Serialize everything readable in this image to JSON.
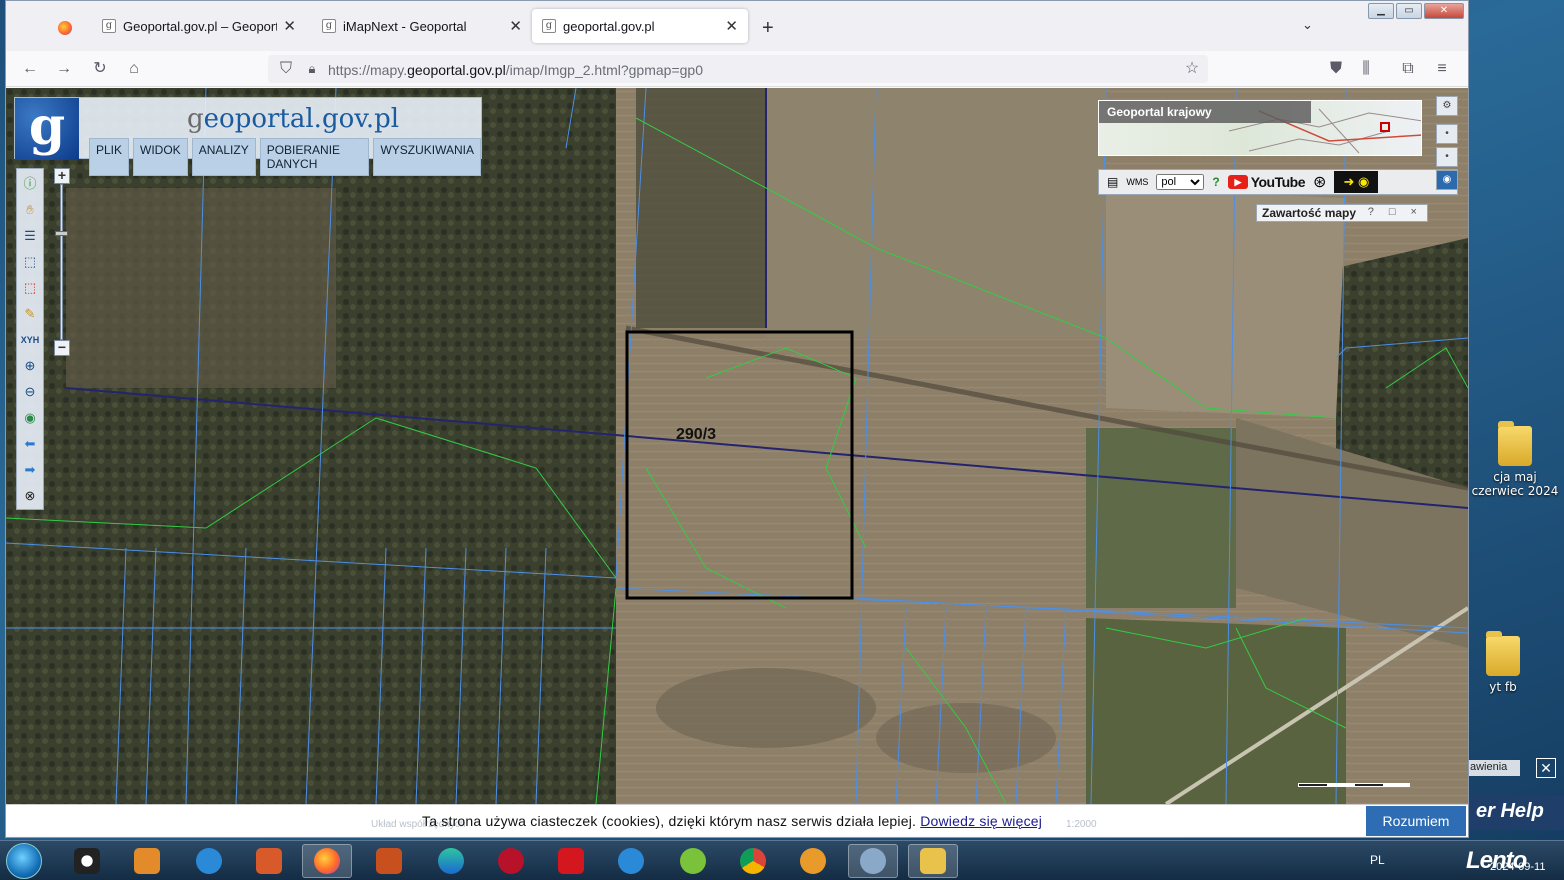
{
  "browser": {
    "tabs": [
      {
        "label": "Geoportal.gov.pl – Geoportal Inf",
        "active": false
      },
      {
        "label": "iMapNext - Geoportal",
        "active": false
      },
      {
        "label": "geoportal.gov.pl",
        "active": true
      }
    ],
    "url_prefix": "https://mapy.",
    "url_domain": "geoportal.gov.pl",
    "url_path": "/imap/Imgp_2.html?gpmap=gp0"
  },
  "geoportal": {
    "logo_letter": "g",
    "logo_text_prefix": "g",
    "logo_text_rest": "eoportal.gov.pl",
    "menu": [
      "PLIK",
      "WIDOK",
      "ANALIZY",
      "POBIERANIE DANYCH",
      "WYSZUKIWANIA"
    ],
    "overview_title": "Geoportal krajowy",
    "language_selected": "pol",
    "youtube_label": "YouTube",
    "map_content_title": "Zawartość mapy",
    "map_content_controls": "? □ ×",
    "parcel_label": "290/3",
    "status_text": "Układ współrzędnych",
    "scale_text": "1:2000"
  },
  "cookie": {
    "text": "Ta strona używa ciasteczek (cookies), dzięki którym nasz serwis działa lepiej.",
    "link": "Dowiedz się więcej",
    "button": "Rozumiem"
  },
  "desktop": {
    "icons": [
      {
        "label": "cja maj czerwiec 2024"
      },
      {
        "label": "yt  fb"
      }
    ],
    "widget_label": "awienia",
    "help_label": "er Help"
  },
  "taskbar": {
    "lang": "PL",
    "date": "2024-09-11",
    "watermark": "Lento"
  },
  "colors": {
    "parcel_line": "#4d8fe6",
    "land_use_line": "#33cc44",
    "road_line": "#24246e",
    "accent": "#2e6db4"
  }
}
